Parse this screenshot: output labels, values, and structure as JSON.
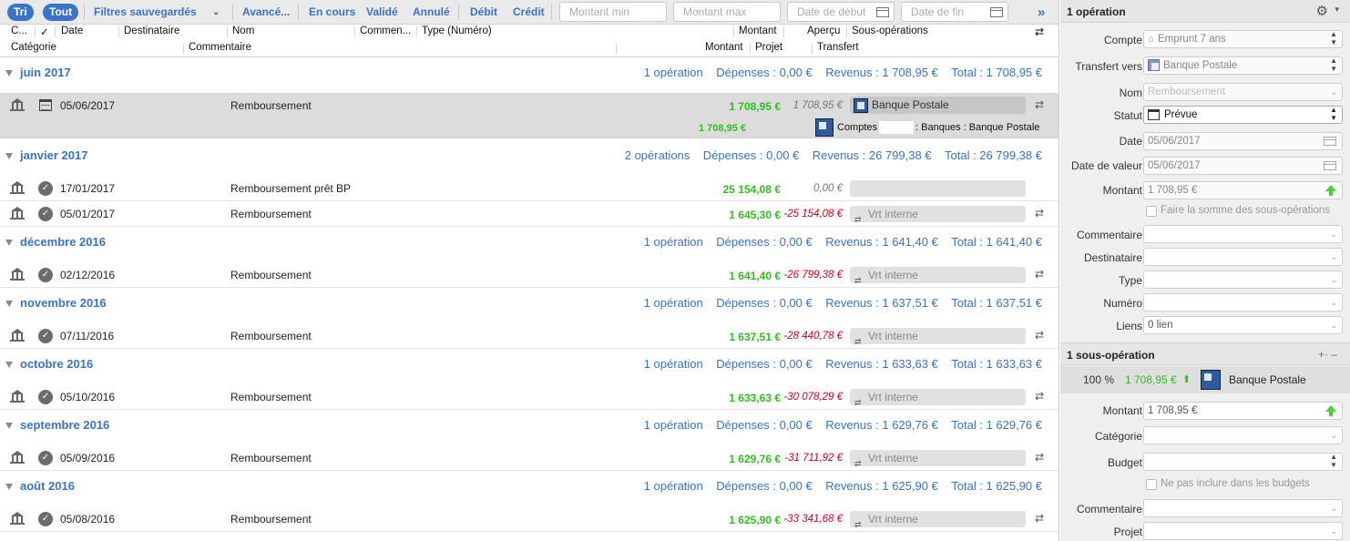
{
  "toolbar": {
    "sort": "Tri",
    "all": "Tout",
    "saved_filters": "Filtres sauvegardés",
    "advanced": "Avancé...",
    "in_progress": "En cours",
    "validated": "Validé",
    "cancelled": "Annulé",
    "debit": "Débit",
    "credit": "Crédit",
    "amount_min_ph": "Montant min",
    "amount_max_ph": "Montant max",
    "date_start_ph": "Date de début",
    "date_end_ph": "Date de fin"
  },
  "columns": {
    "c": "C...",
    "check": "✓",
    "date": "Date",
    "payee": "Destinataire",
    "name": "Nom",
    "comment_short": "Commen...",
    "type": "Type (Numéro)",
    "amount": "Montant",
    "preview": "Aperçu",
    "sub_ops": "Sous-opérations",
    "category": "Catégorie",
    "comment": "Commentaire",
    "amount2": "Montant",
    "project": "Projet",
    "transfer": "Transfert"
  },
  "groups": [
    {
      "title": "juin 2017",
      "count": "1 opération",
      "expenses": "Dépenses : 0,00 €",
      "income": "Revenus : 1 708,95 €",
      "total": "Total : 1 708,95 €"
    },
    {
      "title": "janvier 2017",
      "count": "2 opérations",
      "expenses": "Dépenses : 0,00 €",
      "income": "Revenus : 26 799,38 €",
      "total": "Total : 26 799,38 €"
    },
    {
      "title": "décembre 2016",
      "count": "1 opération",
      "expenses": "Dépenses : 0,00 €",
      "income": "Revenus : 1 641,40 €",
      "total": "Total : 1 641,40 €"
    },
    {
      "title": "novembre 2016",
      "count": "1 opération",
      "expenses": "Dépenses : 0,00 €",
      "income": "Revenus : 1 637,51 €",
      "total": "Total : 1 637,51 €"
    },
    {
      "title": "octobre 2016",
      "count": "1 opération",
      "expenses": "Dépenses : 0,00 €",
      "income": "Revenus : 1 633,63 €",
      "total": "Total : 1 633,63 €"
    },
    {
      "title": "septembre 2016",
      "count": "1 opération",
      "expenses": "Dépenses : 0,00 €",
      "income": "Revenus : 1 629,76 €",
      "total": "Total : 1 629,76 €"
    },
    {
      "title": "août 2016",
      "count": "1 opération",
      "expenses": "Dépenses : 0,00 €",
      "income": "Revenus : 1 625,90 €",
      "total": "Total : 1 625,90 €"
    }
  ],
  "selected_row": {
    "date": "05/06/2017",
    "name": "Remboursement",
    "amount": "1 708,95 €",
    "preview": "1 708,95 €",
    "transfer": "Banque Postale",
    "sub_amount": "1 708,95 €",
    "sub_path_a": "Comptes",
    "sub_path_b": ": Banques : Banque Postale"
  },
  "rows": [
    {
      "date": "17/01/2017",
      "name": "Remboursement prêt BP",
      "amount": "25 154,08 €",
      "preview": "0,00 €",
      "transfer": ""
    },
    {
      "date": "05/01/2017",
      "name": "Remboursement",
      "amount": "1 645,30 €",
      "preview": "-25 154,08 €",
      "transfer": "Vrt interne"
    },
    {
      "date": "02/12/2016",
      "name": "Remboursement",
      "amount": "1 641,40 €",
      "preview": "-26 799,38 €",
      "transfer": "Vrt interne"
    },
    {
      "date": "07/11/2016",
      "name": "Remboursement",
      "amount": "1 637,51 €",
      "preview": "-28 440,78 €",
      "transfer": "Vrt interne"
    },
    {
      "date": "05/10/2016",
      "name": "Remboursement",
      "amount": "1 633,63 €",
      "preview": "-30 078,29 €",
      "transfer": "Vrt interne"
    },
    {
      "date": "05/09/2016",
      "name": "Remboursement",
      "amount": "1 629,76 €",
      "preview": "-31 711,92 €",
      "transfer": "Vrt interne"
    },
    {
      "date": "05/08/2016",
      "name": "Remboursement",
      "amount": "1 625,90 €",
      "preview": "-33 341,68 €",
      "transfer": "Vrt interne"
    }
  ],
  "panel": {
    "header": "1 opération",
    "labels": {
      "account": "Compte",
      "transfer_to": "Transfert vers",
      "name": "Nom",
      "status": "Statut",
      "date": "Date",
      "value_date": "Date de valeur",
      "amount": "Montant",
      "comment": "Commentaire",
      "payee": "Destinataire",
      "type": "Type",
      "number": "Numéro",
      "links": "Liens"
    },
    "values": {
      "account": "Emprunt 7 ans",
      "transfer_to": "Banque Postale",
      "name": "Remboursement",
      "status": "Prévue",
      "date": "05/06/2017",
      "value_date": "05/06/2017",
      "amount": "1 708,95 €",
      "sum_checkbox": "Faire la somme des sous-opérations",
      "links": "0 lien"
    },
    "sub_header": "1 sous-opération",
    "sub_controls": "+· –",
    "sub_line": {
      "percent": "100 %",
      "amount": "1 708,95 €",
      "account": "Banque Postale"
    },
    "sub_labels": {
      "amount": "Montant",
      "category": "Catégorie",
      "budget": "Budget",
      "comment": "Commentaire",
      "project": "Projet"
    },
    "sub_values": {
      "amount": "1 708,95 €",
      "exclude_budget": "Ne pas inclure dans les budgets"
    }
  },
  "colors": {
    "accent": "#3a73c9",
    "positive": "#2fbf1f",
    "negative": "#d0021b"
  }
}
